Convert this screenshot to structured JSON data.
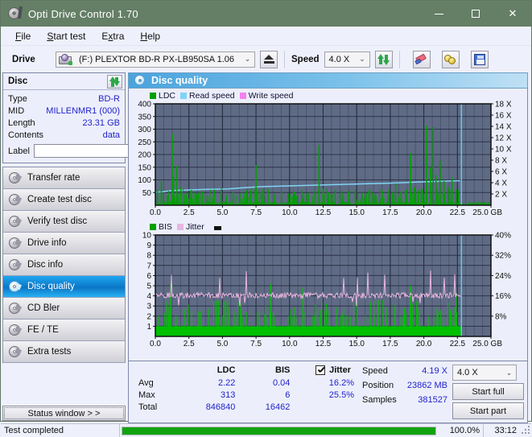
{
  "window": {
    "title": "Opti Drive Control 1.70",
    "icon": "disc-pen-icon",
    "minimize": "minimize-icon",
    "maximize": "maximize-icon",
    "close": "close-icon",
    "titlebar_color": "#647f66"
  },
  "menu": {
    "items": [
      "File",
      "Start test",
      "Extra",
      "Help"
    ]
  },
  "toolbar": {
    "drive_label": "Drive",
    "drive_value": "(F:)  PLEXTOR BD-R  PX-LB950SA 1.06",
    "eject_icon": "eject-icon",
    "speed_label": "Speed",
    "speed_value": "4.0 X",
    "refresh_icon": "refresh-icon",
    "erase_icon": "eraser-icon",
    "gold_icon": "coins-icon",
    "save_icon": "save-icon"
  },
  "disc_panel": {
    "title": "Disc",
    "refresh_icon": "refresh-icon",
    "rows": [
      {
        "key": "Type",
        "value": "BD-R"
      },
      {
        "key": "MID",
        "value": "MILLENMR1 (000)"
      },
      {
        "key": "Length",
        "value": "23.31 GB"
      },
      {
        "key": "Contents",
        "value": "data"
      }
    ],
    "label_key": "Label",
    "label_value": "",
    "label_placeholder": "",
    "disc_icon": "cd-icon"
  },
  "nav": {
    "items": [
      {
        "label": "Transfer rate",
        "icon": "disc-icon",
        "active": false
      },
      {
        "label": "Create test disc",
        "icon": "disc-icon",
        "active": false
      },
      {
        "label": "Verify test disc",
        "icon": "disc-icon",
        "active": false
      },
      {
        "label": "Drive info",
        "icon": "disc-icon",
        "active": false
      },
      {
        "label": "Disc info",
        "icon": "disc-icon",
        "active": false
      },
      {
        "label": "Disc quality",
        "icon": "disc-icon",
        "active": true
      },
      {
        "label": "CD Bler",
        "icon": "disc-icon",
        "active": false
      },
      {
        "label": "FE / TE",
        "icon": "disc-icon",
        "active": false
      },
      {
        "label": "Extra tests",
        "icon": "disc-icon",
        "active": false
      }
    ],
    "status_window_button": "Status window > >"
  },
  "content_header": {
    "title": "Disc quality",
    "icon": "disc-icon"
  },
  "stats": {
    "columns": [
      "LDC",
      "BIS"
    ],
    "jitter_label": "Jitter",
    "jitter_checked": true,
    "rows": [
      {
        "label": "Avg",
        "ldc": "2.22",
        "bis": "0.04",
        "jitter": "16.2%"
      },
      {
        "label": "Max",
        "ldc": "313",
        "bis": "6",
        "jitter": "25.5%"
      },
      {
        "label": "Total",
        "ldc": "846840",
        "bis": "16462",
        "jitter": ""
      }
    ],
    "speed_key": "Speed",
    "speed_value": "4.19 X",
    "position_key": "Position",
    "position_value": "23862 MB",
    "samples_key": "Samples",
    "samples_value": "381527",
    "speed_select": "4.0 X",
    "start_full": "Start full",
    "start_part": "Start part"
  },
  "statusbar": {
    "message": "Test completed",
    "progress_percent": 100,
    "percent_text": "100.0%",
    "time": "33:12"
  },
  "chart_data": [
    {
      "type": "line",
      "name": "ldc-chart",
      "title": "",
      "xlabel": "GB",
      "ylabel": "",
      "legend": [
        {
          "label": "LDC",
          "color": "#00a000"
        },
        {
          "label": "Read speed",
          "color": "#7fd4f5"
        },
        {
          "label": "Write speed",
          "color": "#f57ff0"
        }
      ],
      "x": [
        0,
        25.0
      ],
      "xticks": [
        0.0,
        2.5,
        5.0,
        7.5,
        10.0,
        12.5,
        15.0,
        17.5,
        20.0,
        22.5,
        25.0
      ],
      "xticklabels": [
        "0.0",
        "2.5",
        "5.0",
        "7.5",
        "10.0",
        "12.5",
        "15.0",
        "17.5",
        "20.0",
        "22.5",
        "25.0 GB"
      ],
      "ylim": [
        0,
        400
      ],
      "yticks": [
        50,
        100,
        150,
        200,
        250,
        300,
        350,
        400
      ],
      "yticklabels": [
        "50",
        "100",
        "150",
        "200",
        "250",
        "300",
        "350",
        "400"
      ],
      "y2lim": [
        0,
        18
      ],
      "y2ticks": [
        2,
        4,
        6,
        8,
        10,
        12,
        14,
        16,
        18
      ],
      "y2ticklabels": [
        "2 X",
        "4 X",
        "6 X",
        "8 X",
        "10 X",
        "12 X",
        "14 X",
        "16 X",
        "18 X"
      ],
      "grid": true,
      "series": [
        {
          "name": "Read speed",
          "type": "line",
          "color": "#7fd4f5",
          "points": [
            [
              0.0,
              2.3
            ],
            [
              0.6,
              2.4
            ],
            [
              1.2,
              2.6
            ],
            [
              2.4,
              2.7
            ],
            [
              3.6,
              2.8
            ],
            [
              5.4,
              2.9
            ],
            [
              6.6,
              3.1
            ],
            [
              8.0,
              3.3
            ],
            [
              9.4,
              3.4
            ],
            [
              11.0,
              3.5
            ],
            [
              12.6,
              3.6
            ],
            [
              14.0,
              3.7
            ],
            [
              15.6,
              3.8
            ],
            [
              17.2,
              3.9
            ],
            [
              18.4,
              4.0
            ],
            [
              19.4,
              4.1
            ],
            [
              20.6,
              4.2
            ],
            [
              21.8,
              4.3
            ],
            [
              22.7,
              4.35
            ]
          ]
        },
        {
          "name": "LDC",
          "type": "spikes",
          "color": "#00a000",
          "baseline_avg": 2.22,
          "max": 313,
          "spikes": [
            [
              0.15,
              60
            ],
            [
              0.45,
              95
            ],
            [
              0.9,
              38
            ],
            [
              1.25,
              283
            ],
            [
              1.35,
              112
            ],
            [
              1.6,
              155
            ],
            [
              1.9,
              70
            ],
            [
              2.3,
              48
            ],
            [
              2.7,
              60
            ],
            [
              3.1,
              42
            ],
            [
              3.5,
              55
            ],
            [
              3.9,
              38
            ],
            [
              4.4,
              62
            ],
            [
              4.9,
              45
            ],
            [
              5.3,
              40
            ],
            [
              5.8,
              52
            ],
            [
              6.3,
              48
            ],
            [
              6.8,
              60
            ],
            [
              7.1,
              45
            ],
            [
              7.5,
              158
            ],
            [
              7.9,
              52
            ],
            [
              8.4,
              64
            ],
            [
              8.9,
              44
            ],
            [
              9.4,
              56
            ],
            [
              9.9,
              48
            ],
            [
              10.4,
              52
            ],
            [
              10.9,
              60
            ],
            [
              11.4,
              46
            ],
            [
              11.9,
              58
            ],
            [
              12.2,
              238
            ],
            [
              12.5,
              66
            ],
            [
              12.9,
              50
            ],
            [
              13.4,
              60
            ],
            [
              13.9,
              48
            ],
            [
              14.4,
              56
            ],
            [
              14.9,
              62
            ],
            [
              15.4,
              50
            ],
            [
              15.9,
              58
            ],
            [
              16.4,
              46
            ],
            [
              16.9,
              54
            ],
            [
              17.4,
              60
            ],
            [
              17.9,
              86
            ],
            [
              18.3,
              52
            ],
            [
              18.7,
              62
            ],
            [
              19.0,
              205
            ],
            [
              19.3,
              70
            ],
            [
              19.6,
              58
            ],
            [
              19.9,
              64
            ],
            [
              20.2,
              313
            ],
            [
              20.5,
              150
            ],
            [
              20.7,
              308
            ],
            [
              20.9,
              120
            ],
            [
              21.2,
              175
            ],
            [
              21.5,
              96
            ],
            [
              21.8,
              72
            ],
            [
              22.1,
              110
            ],
            [
              22.4,
              64
            ],
            [
              22.6,
              58
            ]
          ]
        },
        {
          "name": "position-marker",
          "type": "vline",
          "color": "#63c8f0",
          "x": 22.8
        }
      ]
    },
    {
      "type": "line",
      "name": "bis-chart",
      "title": "",
      "xlabel": "GB",
      "ylabel": "",
      "legend": [
        {
          "label": "BIS",
          "color": "#00a000"
        },
        {
          "label": "Jitter",
          "color": "#e8b6e0"
        }
      ],
      "x": [
        0,
        25.0
      ],
      "xticks": [
        0.0,
        2.5,
        5.0,
        7.5,
        10.0,
        12.5,
        15.0,
        17.5,
        20.0,
        22.5,
        25.0
      ],
      "xticklabels": [
        "0.0",
        "2.5",
        "5.0",
        "7.5",
        "10.0",
        "12.5",
        "15.0",
        "17.5",
        "20.0",
        "22.5",
        "25.0 GB"
      ],
      "ylim": [
        0,
        10
      ],
      "yticks": [
        1,
        2,
        3,
        4,
        5,
        6,
        7,
        8,
        9,
        10
      ],
      "yticklabels": [
        "1",
        "2",
        "3",
        "4",
        "5",
        "6",
        "7",
        "8",
        "9",
        "10"
      ],
      "y2lim": [
        0,
        40
      ],
      "y2ticks": [
        8,
        16,
        24,
        32,
        40
      ],
      "y2ticklabels": [
        "8%",
        "16%",
        "24%",
        "32%",
        "40%"
      ],
      "grid": true,
      "series": [
        {
          "name": "BIS",
          "type": "bars",
          "color": "#00c000",
          "baseline": 1.0,
          "avg": 0.04,
          "max": 6
        },
        {
          "name": "Jitter",
          "type": "line",
          "color": "#e8b6e0",
          "avg_pct": 16.2,
          "max_pct": 25.5,
          "baseline_value": 4.05
        },
        {
          "name": "position-marker",
          "type": "vline",
          "color": "#63c8f0",
          "x": 22.8
        }
      ]
    }
  ]
}
